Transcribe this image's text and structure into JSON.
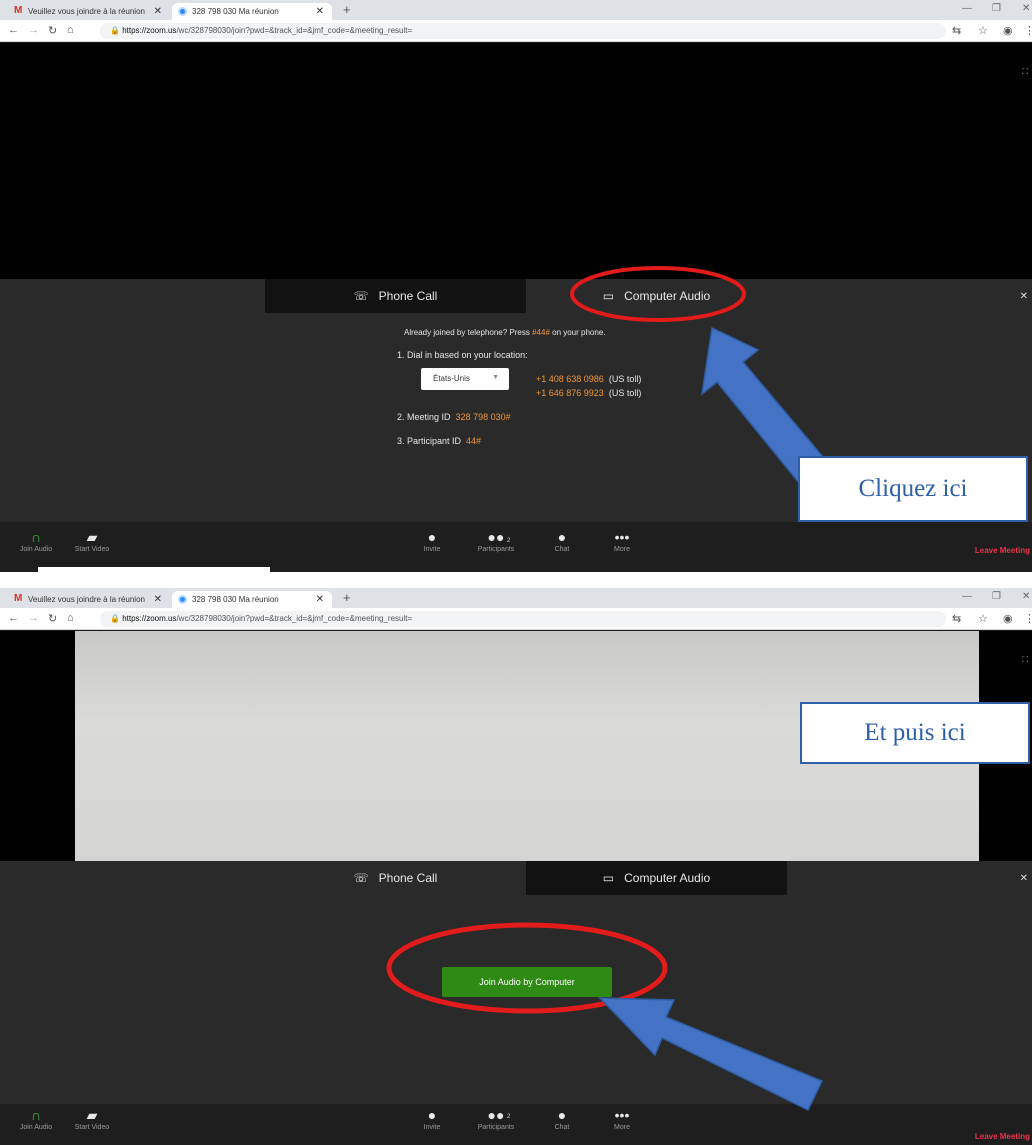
{
  "browser": {
    "tab1_title": "Veuillez vous joindre à la réunion",
    "tab2_title": "328 798 030 Ma réunion",
    "url_host": "https://zoom.us",
    "url_path": "/wc/328798030/join?pwd=&track_id=&jmf_code=&meeting_result="
  },
  "dialog": {
    "tab_phone": "Phone Call",
    "tab_computer": "Computer Audio",
    "already_joined_pre": "Already joined by telephone? Press ",
    "already_joined_code": "#44#",
    "already_joined_post": " on your phone.",
    "step1": "1. Dial in based on your location:",
    "country": "États-Unis",
    "number1": "+1 408 638 0986",
    "number1_note": "(US toll)",
    "number2": "+1 646 876 9923",
    "number2_note": "(US toll)",
    "step2_label": "2. Meeting ID",
    "meeting_id": "328 798 030#",
    "step3_label": "3. Participant ID",
    "participant_id": "44#",
    "join_button": "Join Audio by Computer"
  },
  "toolbar": {
    "join_audio": "Join Audio",
    "start_video": "Start Video",
    "invite": "Invite",
    "participants": "Participants",
    "participants_count": "2",
    "chat": "Chat",
    "more": "More",
    "leave": "Leave Meeting"
  },
  "annotations": {
    "callout1": "Cliquez ici",
    "callout2": "Et puis ici"
  },
  "colors": {
    "accent_orange": "#f0953a",
    "join_green": "#2e8a13",
    "leave_red": "#e8334c",
    "annotation_red": "#e31b1b",
    "arrow_blue": "#4472c4"
  },
  "icons": [
    "gmail-icon",
    "zoom-icon",
    "back-icon",
    "forward-icon",
    "reload-icon",
    "home-icon",
    "lock-icon",
    "translate-icon",
    "star-icon",
    "profile-icon",
    "phone-icon",
    "computer-icon",
    "headphones-icon",
    "video-off-icon",
    "invite-icon",
    "participants-icon",
    "chat-icon",
    "more-icon"
  ]
}
